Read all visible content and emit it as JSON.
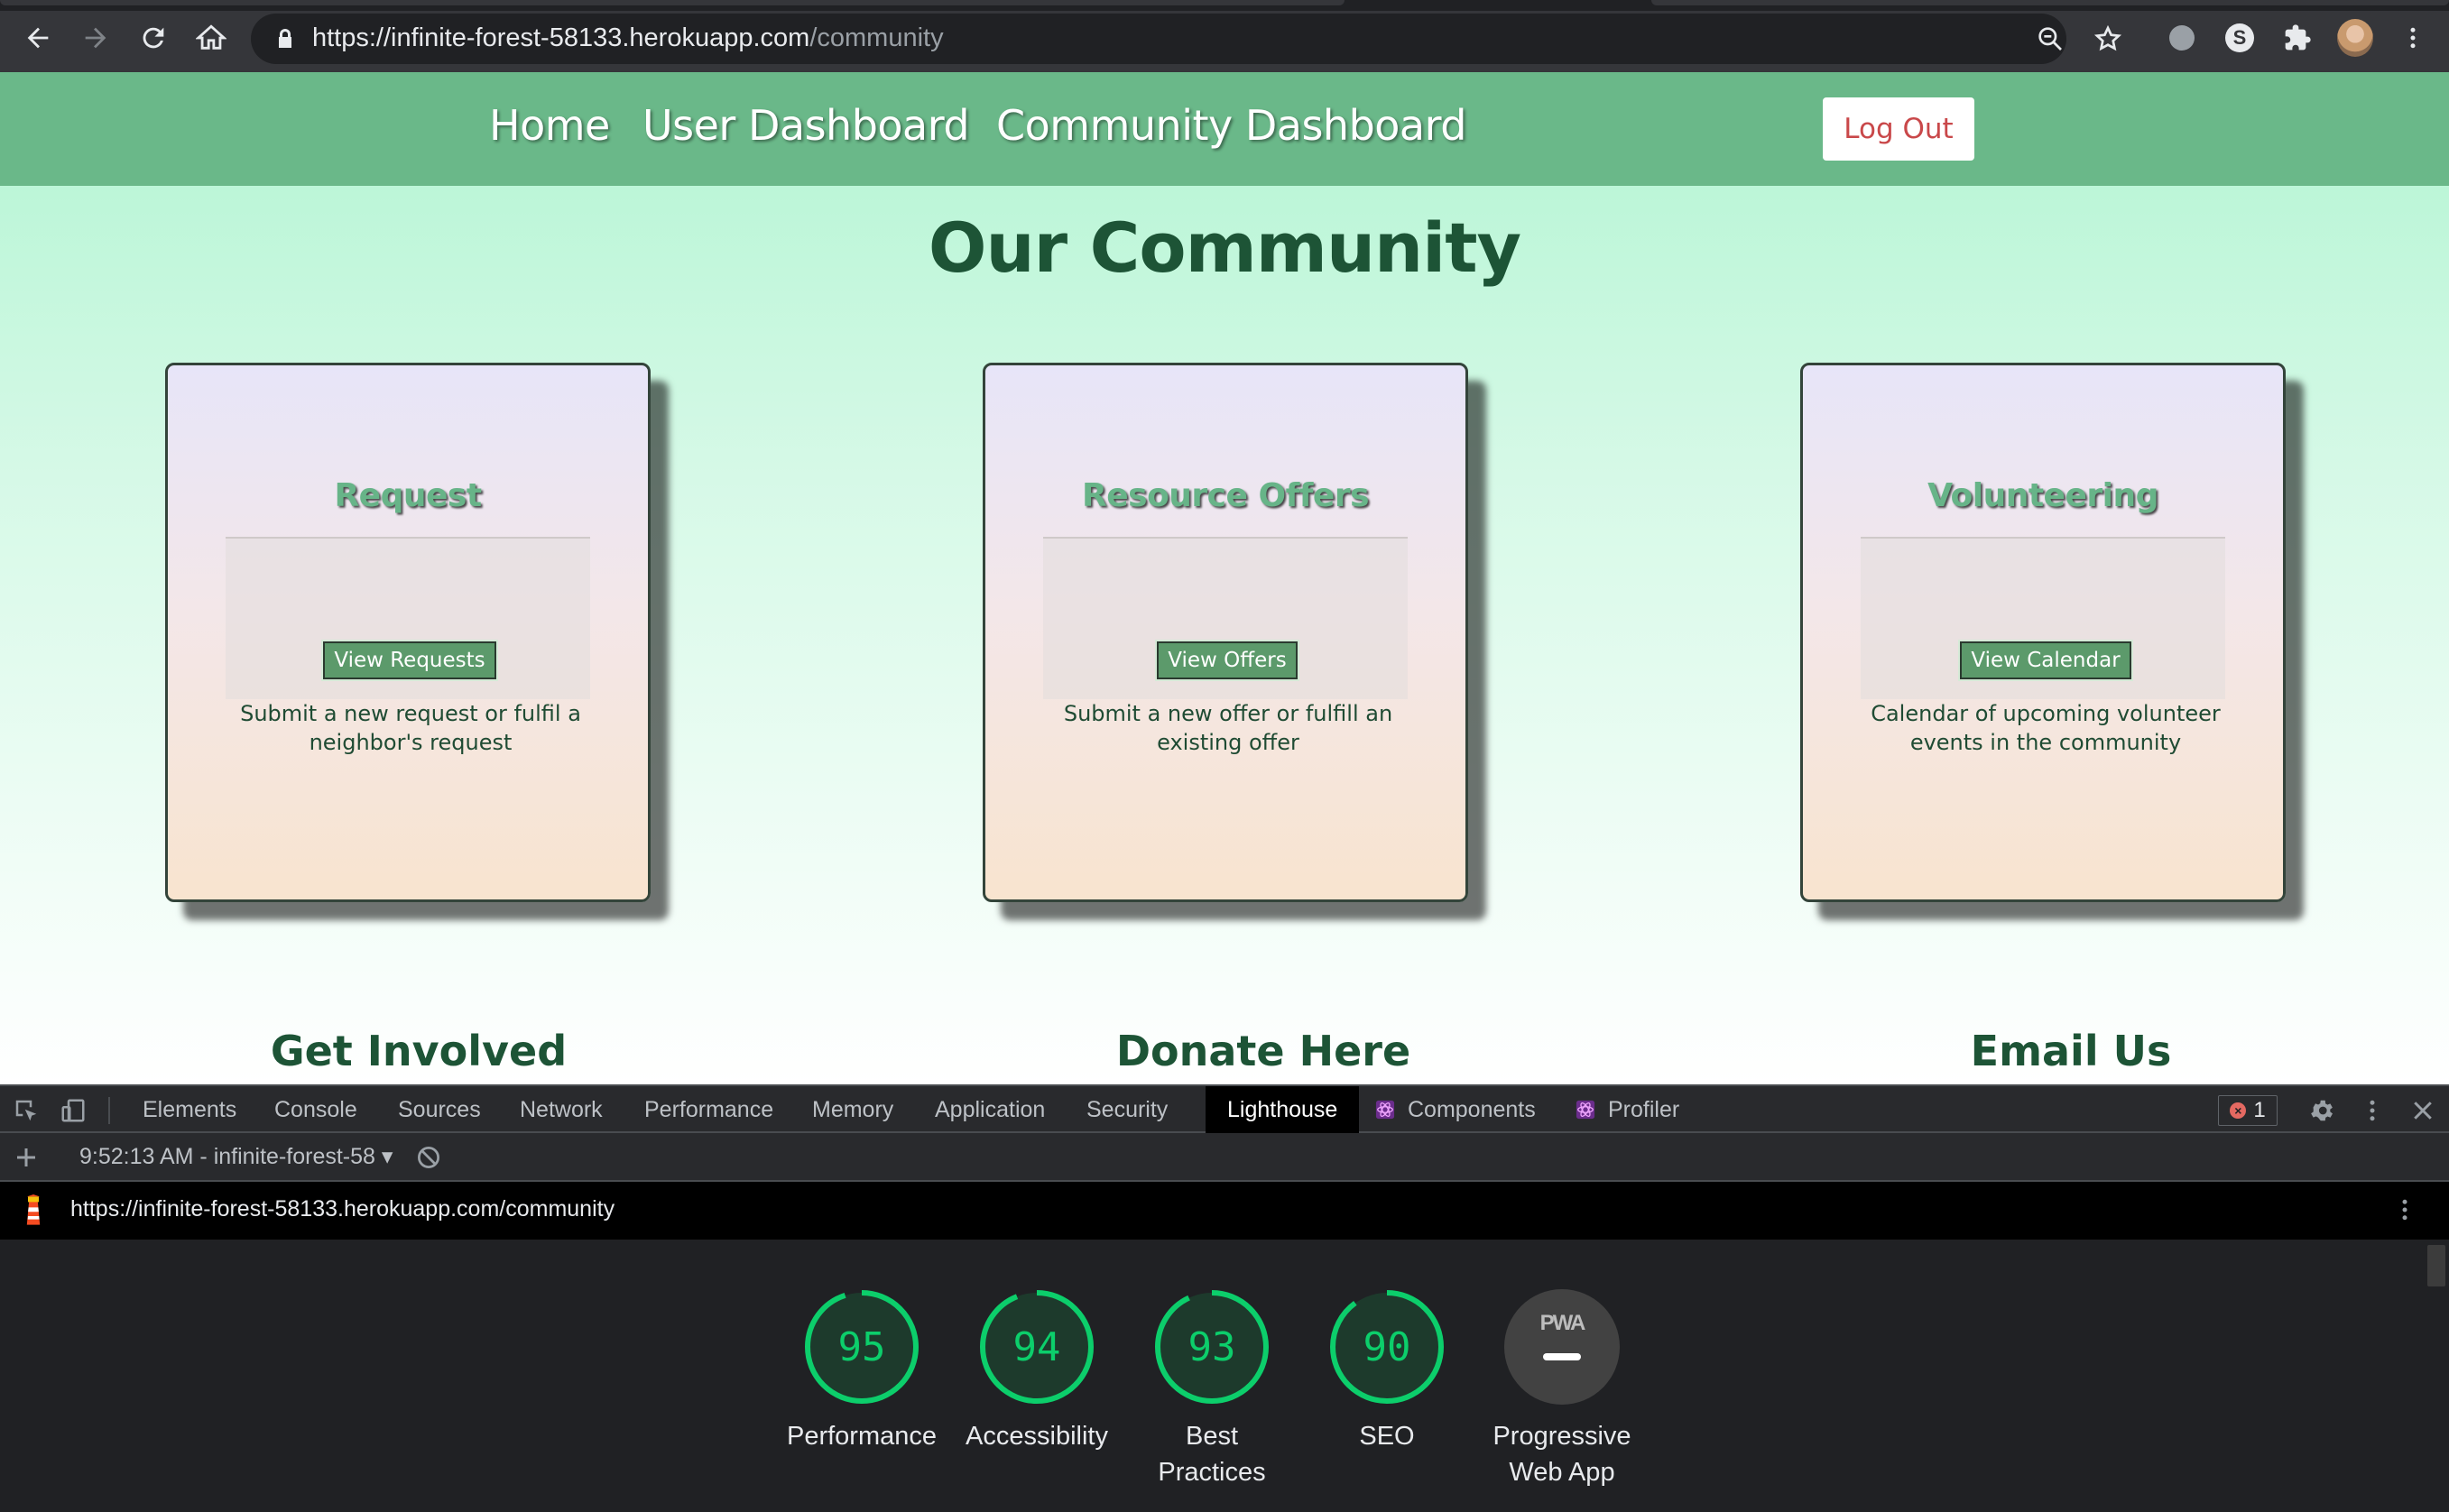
{
  "browser": {
    "url_host": "https://infinite-forest-58133.herokuapp.com",
    "url_path": "/community"
  },
  "nav": {
    "home": "Home",
    "user_dashboard": "User Dashboard",
    "community_dashboard": "Community Dashboard",
    "logout": "Log Out"
  },
  "page": {
    "title": "Our Community",
    "cards": [
      {
        "title": "Request",
        "button": "View Requests",
        "description": "Submit a new request or fulfil a neighbor's request"
      },
      {
        "title": "Resource Offers",
        "button": "View Offers",
        "description": "Submit a new offer or fulfill an existing offer"
      },
      {
        "title": "Volunteering",
        "button": "View Calendar",
        "description": "Calendar of upcoming volunteer events in the community"
      }
    ],
    "footer": [
      "Get Involved",
      "Donate Here",
      "Email Us"
    ]
  },
  "devtools": {
    "tabs": [
      "Elements",
      "Console",
      "Sources",
      "Network",
      "Performance",
      "Memory",
      "Application",
      "Security",
      "Lighthouse",
      "Components",
      "Profiler"
    ],
    "active_tab": "Lighthouse",
    "error_count": "1",
    "report_select": "9:52:13 AM - infinite-forest-58",
    "report_url": "https://infinite-forest-58133.herokuapp.com/community",
    "scores": [
      {
        "label": "Performance",
        "score": "95",
        "value": 95
      },
      {
        "label": "Accessibility",
        "score": "94",
        "value": 94
      },
      {
        "label": "Best Practices",
        "score": "93",
        "value": 93
      },
      {
        "label": "SEO",
        "score": "90",
        "value": 90
      }
    ],
    "pwa": {
      "badge": "PWA",
      "label": "Progressive Web App"
    },
    "colors": {
      "pass": "#0cce6b",
      "accent_nav": "#6ab889"
    }
  }
}
